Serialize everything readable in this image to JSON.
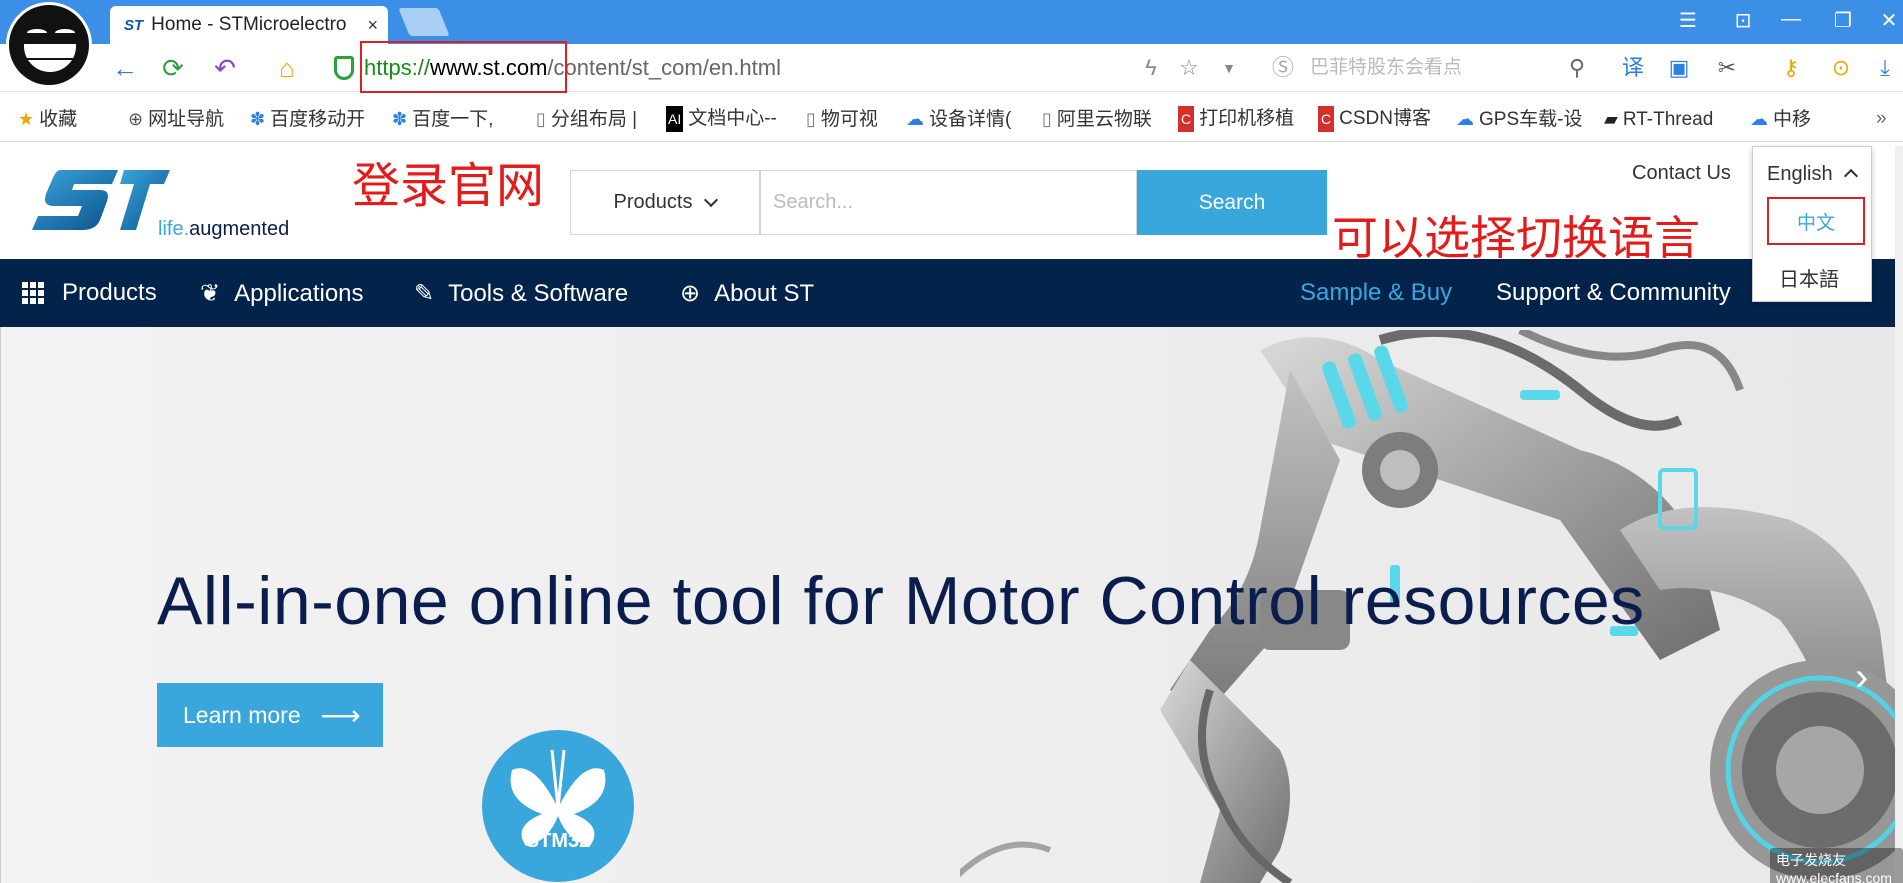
{
  "browser": {
    "tab_title": "Home - STMicroelectro",
    "tab_favicon": "ST",
    "tab_close": "×",
    "url_scheme": "https://",
    "url_host": "www.st.com",
    "url_path": "/content/st_com/en.html",
    "search_hint": "巴菲特股东会看点",
    "window_controls": [
      "☰",
      "⊡",
      "—",
      "❐",
      "✕"
    ]
  },
  "bookmarks": [
    {
      "icon": "★",
      "label": "收藏"
    },
    {
      "icon": "⊕",
      "label": "网址导航"
    },
    {
      "icon": "✽",
      "label": "百度移动开"
    },
    {
      "icon": "✽",
      "label": "百度一下,"
    },
    {
      "icon": "▯",
      "label": "分组布局 |"
    },
    {
      "icon": "AI",
      "label": "文档中心--"
    },
    {
      "icon": "▯",
      "label": "物可视"
    },
    {
      "icon": "☁",
      "label": "设备详情("
    },
    {
      "icon": "▯",
      "label": "阿里云物联"
    },
    {
      "icon": "C",
      "label": "打印机移植"
    },
    {
      "icon": "C",
      "label": "CSDN博客"
    },
    {
      "icon": "☁",
      "label": "GPS车载-设"
    },
    {
      "icon": "▰",
      "label": "RT-Thread"
    },
    {
      "icon": "☁",
      "label": "中移"
    }
  ],
  "site": {
    "tagline_life": "life.",
    "tagline_rest": "augmented",
    "products_dropdown": "Products",
    "search_placeholder": "Search...",
    "search_button": "Search",
    "contact": "Contact Us",
    "language": {
      "current": "English",
      "options": [
        "中文",
        "日本語"
      ]
    },
    "nav": {
      "products": "Products",
      "applications": "Applications",
      "tools": "Tools & Software",
      "about": "About ST",
      "sample": "Sample & Buy",
      "support": "Support & Community"
    },
    "hero": {
      "title": "All-in-one online tool for Motor Control resources",
      "button": "Learn more",
      "badge": "STM32"
    }
  },
  "annotations": {
    "login": "登录官网",
    "switch_lang": "可以选择切换语言"
  },
  "watermark": "电子发烧友 www.elecfans.com",
  "colors": {
    "browser_blue": "#3b8fe6",
    "st_navy": "#03234b",
    "st_blue": "#3aa7dc",
    "annotation_red": "#e41b1b"
  }
}
